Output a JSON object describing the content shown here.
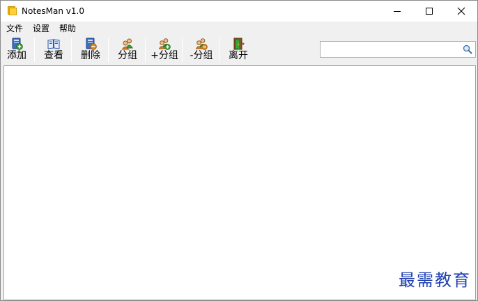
{
  "window": {
    "title": "NotesMan v1.0",
    "controls": {
      "minimize_icon": "minimize-icon",
      "maximize_icon": "maximize-icon",
      "close_icon": "close-icon"
    }
  },
  "menu": {
    "items": [
      {
        "label": "文件"
      },
      {
        "label": "设置"
      },
      {
        "label": "帮助"
      }
    ]
  },
  "toolbar": {
    "buttons": [
      {
        "label": "添加",
        "icon": "add-note-icon"
      },
      {
        "label": "查看",
        "icon": "view-book-icon"
      },
      {
        "label": "删除",
        "icon": "delete-note-icon"
      },
      {
        "label": "分组",
        "icon": "group-users-icon"
      },
      {
        "label": "+分组",
        "icon": "add-group-icon"
      },
      {
        "label": "-分组",
        "icon": "remove-group-icon"
      },
      {
        "label": "离开",
        "icon": "exit-door-icon"
      }
    ]
  },
  "search": {
    "value": "",
    "icon": "search-icon"
  },
  "content": {
    "watermark": "最需教育"
  },
  "colors": {
    "title_bar": "#ffffff",
    "chrome": "#f0f0f0",
    "watermark": "#2040b0",
    "app_icon": "#f3b400"
  }
}
